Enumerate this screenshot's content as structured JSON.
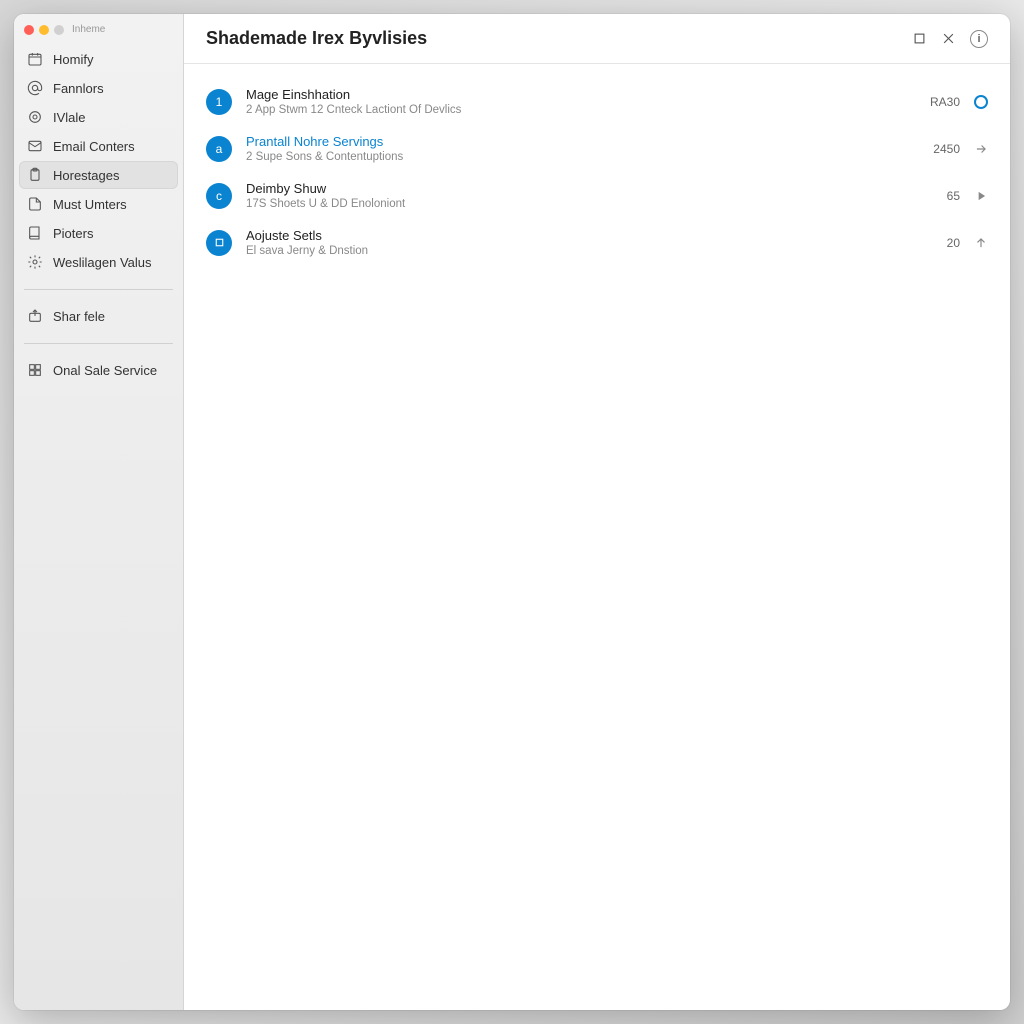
{
  "app_label": "Inheme",
  "header": {
    "title": "Shademade Irex Byvlisies",
    "info_badge": "i"
  },
  "sidebar": {
    "items": [
      {
        "label": "Homify",
        "icon": "calendar"
      },
      {
        "label": "Fannlors",
        "icon": "at"
      },
      {
        "label": "IVlale",
        "icon": "circle"
      },
      {
        "label": "Email Conters",
        "icon": "mail"
      },
      {
        "label": "Horestages",
        "icon": "clipboard",
        "active": true
      },
      {
        "label": "Must Umters",
        "icon": "file"
      },
      {
        "label": "Pioters",
        "icon": "book"
      },
      {
        "label": "Weslilagen Valus",
        "icon": "gear"
      }
    ],
    "group2": [
      {
        "label": "Shar fele",
        "icon": "share"
      }
    ],
    "group3": [
      {
        "label": "Onal Sale Service",
        "icon": "grid"
      }
    ]
  },
  "list": [
    {
      "avatar": "1",
      "title": "Mage Einshhation",
      "subtitle": "2 App Stwm 12 Cnteck Lactiont Of Devlics",
      "meta": "RA30",
      "action": "toggle",
      "accent": false
    },
    {
      "avatar": "a",
      "title": "Prantall Nohre Servings",
      "subtitle": "2 Supe Sons & Contentuptions",
      "meta": "2450",
      "action": "arrow-right",
      "accent": true
    },
    {
      "avatar": "c",
      "title": "Deimby Shuw",
      "subtitle": "17S Shoets U & DD Enoloniont",
      "meta": "65",
      "action": "play",
      "accent": false
    },
    {
      "avatar": "□",
      "title": "Aojuste Setls",
      "subtitle": "El sava Jerny & Dnstion",
      "meta": "20",
      "action": "arrow-up",
      "accent": false
    }
  ]
}
